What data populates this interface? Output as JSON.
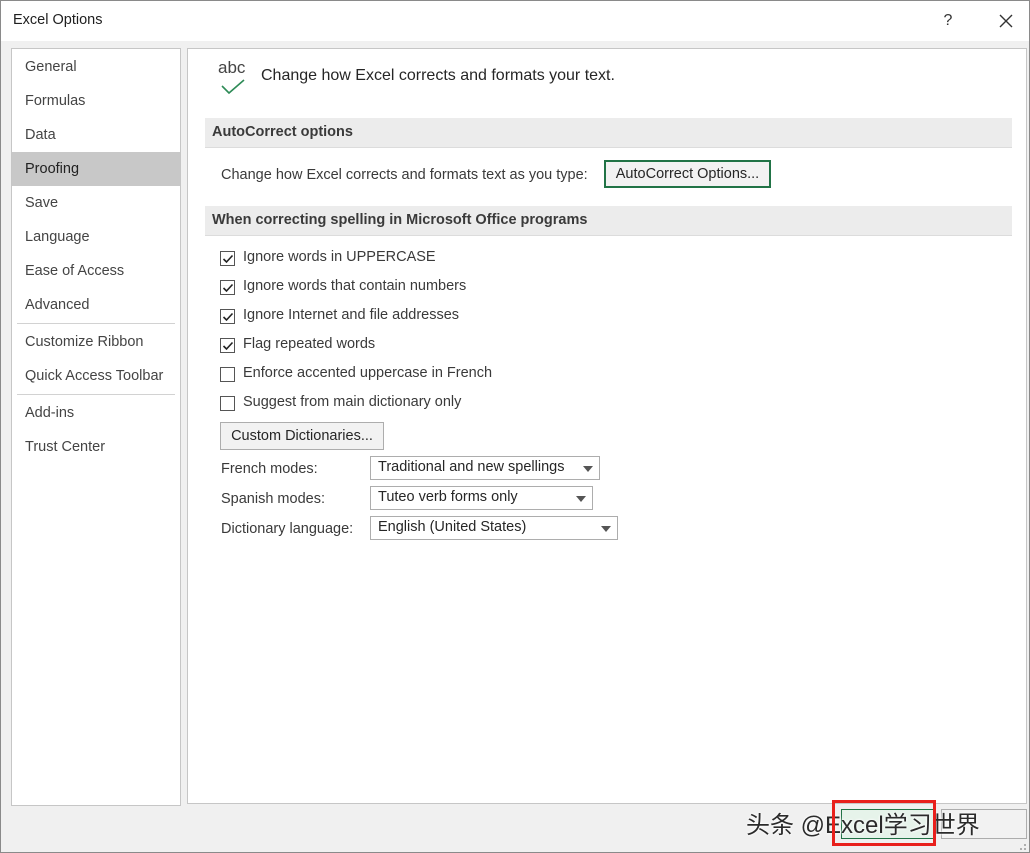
{
  "window": {
    "title": "Excel Options",
    "help_label": "?"
  },
  "sidebar": {
    "items": [
      {
        "label": "General"
      },
      {
        "label": "Formulas"
      },
      {
        "label": "Data"
      },
      {
        "label": "Proofing",
        "active": true
      },
      {
        "label": "Save"
      },
      {
        "label": "Language"
      },
      {
        "label": "Ease of Access"
      },
      {
        "label": "Advanced"
      },
      {
        "label": "Customize Ribbon"
      },
      {
        "label": "Quick Access Toolbar"
      },
      {
        "label": "Add-ins"
      },
      {
        "label": "Trust Center"
      }
    ]
  },
  "header": {
    "icon_text": "abc",
    "text": "Change how Excel corrects and formats your text."
  },
  "autocorrect": {
    "section_title": "AutoCorrect options",
    "description": "Change how Excel corrects and formats text as you type:",
    "button_label": "AutoCorrect Options..."
  },
  "spelling": {
    "section_title": "When correcting spelling in Microsoft Office programs",
    "checkboxes": [
      {
        "label": "Ignore words in UPPERCASE",
        "checked": true
      },
      {
        "label": "Ignore words that contain numbers",
        "checked": true
      },
      {
        "label": "Ignore Internet and file addresses",
        "checked": true
      },
      {
        "label": "Flag repeated words",
        "checked": true
      },
      {
        "label": "Enforce accented uppercase in French",
        "checked": false
      },
      {
        "label": "Suggest from main dictionary only",
        "checked": false
      }
    ],
    "custom_dict_label": "Custom Dictionaries...",
    "french_modes": {
      "label": "French modes:",
      "value": "Traditional and new spellings"
    },
    "spanish_modes": {
      "label": "Spanish modes:",
      "value": "Tuteo verb forms only"
    },
    "dictionary_language": {
      "label": "Dictionary language:",
      "value": "English (United States)"
    }
  },
  "footer": {
    "watermark": "头条 @Excel学习世界",
    "accent_color": "#217346",
    "highlight_color": "#e8201c"
  }
}
